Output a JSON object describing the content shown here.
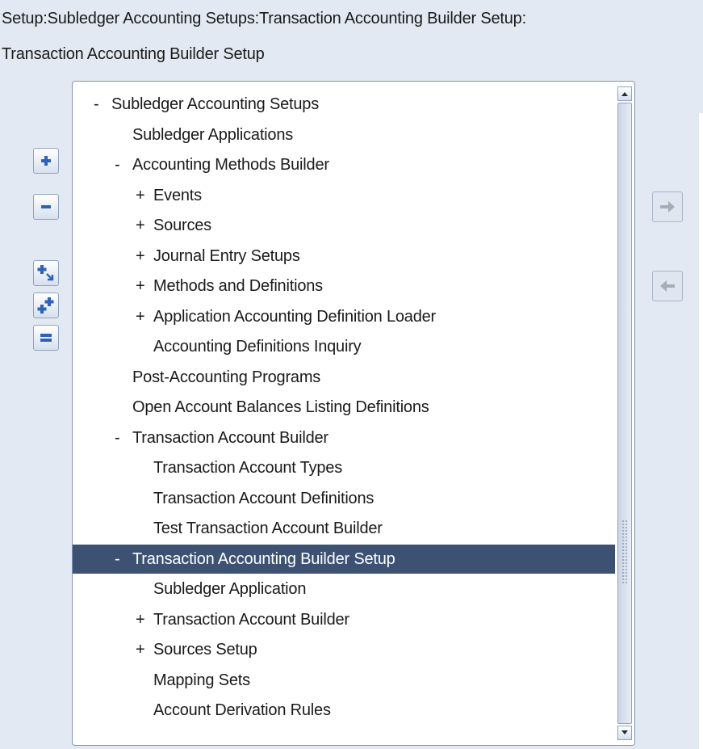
{
  "header": {
    "breadcrumb": "Setup:Subledger Accounting Setups:Transaction Accounting Builder Setup:",
    "form_title": "Transaction Accounting Builder Setup"
  },
  "toolbar": {
    "buttons": [
      {
        "name": "expand-icon",
        "label": "Expand"
      },
      {
        "name": "collapse-icon",
        "label": "Collapse"
      },
      {
        "name": "expand-branch-icon",
        "label": "Expand Branch"
      },
      {
        "name": "expand-all-icon",
        "label": "Expand All"
      },
      {
        "name": "collapse-all-icon",
        "label": "Collapse All"
      }
    ]
  },
  "navigator": {
    "add_arrow": "right-arrow-icon",
    "remove_arrow": "left-arrow-icon"
  },
  "tree": {
    "selected_index": 15,
    "nodes": [
      {
        "sign": "-",
        "label": "Subledger Accounting Setups",
        "level": 0
      },
      {
        "sign": "",
        "label": "Subledger Applications",
        "level": 1
      },
      {
        "sign": "-",
        "label": "Accounting Methods Builder",
        "level": 1
      },
      {
        "sign": "+",
        "label": "Events",
        "level": 2
      },
      {
        "sign": "+",
        "label": "Sources",
        "level": 2
      },
      {
        "sign": "+",
        "label": "Journal Entry Setups",
        "level": 2
      },
      {
        "sign": "+",
        "label": "Methods and Definitions",
        "level": 2
      },
      {
        "sign": "+",
        "label": "Application Accounting Definition Loader",
        "level": 2
      },
      {
        "sign": "",
        "label": "Accounting Definitions Inquiry",
        "level": 2
      },
      {
        "sign": "",
        "label": "Post-Accounting Programs",
        "level": 1
      },
      {
        "sign": "",
        "label": "Open Account Balances Listing Definitions",
        "level": 1
      },
      {
        "sign": "-",
        "label": "Transaction Account Builder",
        "level": 1
      },
      {
        "sign": "",
        "label": "Transaction Account Types",
        "level": 2
      },
      {
        "sign": "",
        "label": "Transaction Account Definitions",
        "level": 2
      },
      {
        "sign": "",
        "label": "Test Transaction Account Builder",
        "level": 2
      },
      {
        "sign": "-",
        "label": "Transaction Accounting Builder Setup",
        "level": 1
      },
      {
        "sign": "",
        "label": "Subledger Application",
        "level": 2
      },
      {
        "sign": "+",
        "label": "Transaction Account Builder",
        "level": 2
      },
      {
        "sign": "+",
        "label": "Sources Setup",
        "level": 2
      },
      {
        "sign": "",
        "label": "Mapping Sets",
        "level": 2
      },
      {
        "sign": "",
        "label": "Account Derivation Rules",
        "level": 2
      }
    ]
  },
  "colors": {
    "selection": "#3d5273",
    "icon_blue": "#2f62b7",
    "background": "#e3e9f2"
  }
}
